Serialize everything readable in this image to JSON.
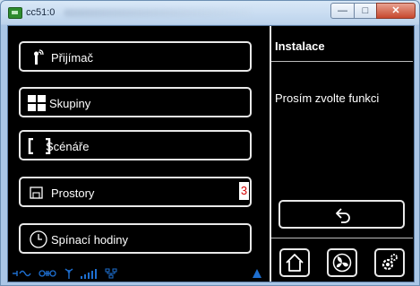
{
  "window": {
    "title": "cc51:0",
    "controls": {
      "minimize": "—",
      "maximize": "□",
      "close": "✕"
    }
  },
  "menu": {
    "items": [
      {
        "label": "Přijímač",
        "icon": "receiver-icon"
      },
      {
        "label": "Skupiny",
        "icon": "groups-grid-icon"
      },
      {
        "label": "Scénáře",
        "icon": "brackets-icon"
      },
      {
        "label": "Prostory",
        "icon": "room-icon",
        "badge": "3"
      },
      {
        "label": "Spínací hodiny",
        "icon": "clock-icon"
      }
    ]
  },
  "panel": {
    "title": "Instalace",
    "hint": "Prosím zvolte funkci"
  },
  "status": {
    "icons": [
      "bus-icon",
      "link-icon",
      "antenna-icon",
      "signal-bars-icon",
      "network-icon",
      "warning-triangle-icon"
    ]
  },
  "colors": {
    "accent": "#1e6fd0",
    "badge_text": "#d40000",
    "panel_bg": "#000000",
    "frame": "#aac6e6"
  }
}
